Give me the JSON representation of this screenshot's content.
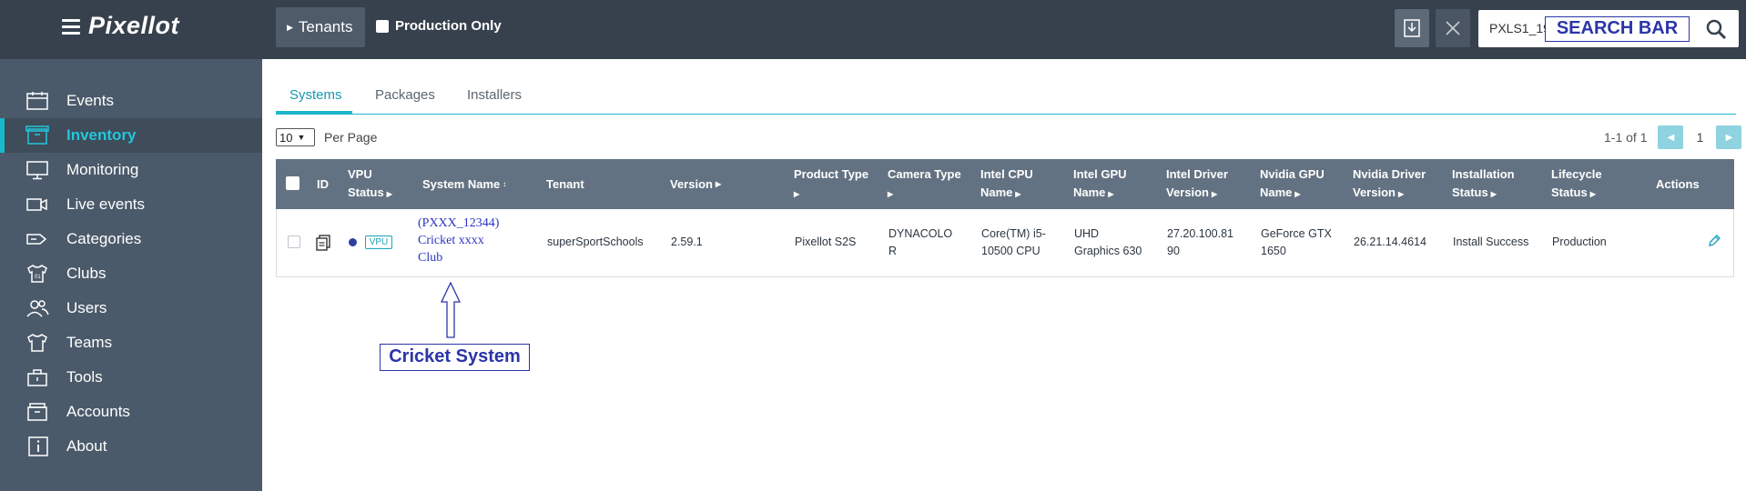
{
  "app": {
    "logo_text": "Pixellot"
  },
  "sidebar": {
    "items": [
      {
        "label": "Events",
        "icon": "calendar-icon",
        "active": false
      },
      {
        "label": "Inventory",
        "icon": "box-icon",
        "active": true
      },
      {
        "label": "Monitoring",
        "icon": "monitor-icon",
        "active": false
      },
      {
        "label": "Live events",
        "icon": "video-camera-icon",
        "active": false
      },
      {
        "label": "Categories",
        "icon": "tag-icon",
        "active": false
      },
      {
        "label": "Clubs",
        "icon": "jersey-icon",
        "active": false
      },
      {
        "label": "Users",
        "icon": "users-icon",
        "active": false
      },
      {
        "label": "Teams",
        "icon": "shirt-icon",
        "active": false
      },
      {
        "label": "Tools",
        "icon": "toolbox-icon",
        "active": false
      },
      {
        "label": "Accounts",
        "icon": "briefcase-icon",
        "active": false
      },
      {
        "label": "About",
        "icon": "info-icon",
        "active": false
      }
    ]
  },
  "topbar": {
    "tenants_label": "Tenants",
    "production_only_label": "Production Only",
    "search_value": "PXLS1_19",
    "search_annotation": "SEARCH BAR"
  },
  "tabs": [
    "Systems",
    "Packages",
    "Installers"
  ],
  "active_tab": "Systems",
  "pagination": {
    "per_page_value": "10",
    "per_page_label": "Per Page",
    "range_text": "1-1 of 1",
    "current_page": "1"
  },
  "table": {
    "headers": {
      "id": "ID",
      "vpu_status": [
        "VPU",
        "Status"
      ],
      "system_name": "System Name",
      "tenant": "Tenant",
      "version": "Version",
      "product_type": [
        "Product Type",
        ""
      ],
      "camera_type": [
        "Camera Type",
        ""
      ],
      "intel_cpu": [
        "Intel CPU",
        "Name"
      ],
      "intel_gpu": [
        "Intel GPU",
        "Name"
      ],
      "intel_driver": [
        "Intel Driver",
        "Version"
      ],
      "nvidia_gpu": [
        "Nvidia GPU",
        "Name"
      ],
      "nvidia_driver": [
        "Nvidia Driver",
        "Version"
      ],
      "installation_status": [
        "Installation",
        "Status"
      ],
      "lifecycle_status": [
        "Lifecycle",
        "Status"
      ],
      "actions": "Actions"
    },
    "rows": [
      {
        "vpu_badge": "VPU",
        "system_name": [
          "(PXXX_12344)",
          "Cricket xxxx",
          "Club"
        ],
        "tenant": "superSportSchools",
        "version": "2.59.1",
        "product_type": "Pixellot S2S",
        "camera_type": [
          "DYNACOLO",
          "R"
        ],
        "intel_cpu": [
          "Core(TM) i5-",
          "10500 CPU"
        ],
        "intel_gpu": [
          "UHD",
          "Graphics 630"
        ],
        "intel_driver": [
          "27.20.100.81",
          "90"
        ],
        "nvidia_gpu": [
          "GeForce GTX",
          "1650"
        ],
        "nvidia_driver": "26.21.14.4614",
        "installation_status": "Install Success",
        "lifecycle_status": "Production"
      }
    ]
  },
  "annotations": {
    "cricket_label": "Cricket System"
  },
  "colors": {
    "sidebar_bg": "#4b5a6a",
    "topbar_bg": "#37414d",
    "accent": "#1bb7cc",
    "table_header_bg": "#637282",
    "annotation": "#2b35a8"
  }
}
